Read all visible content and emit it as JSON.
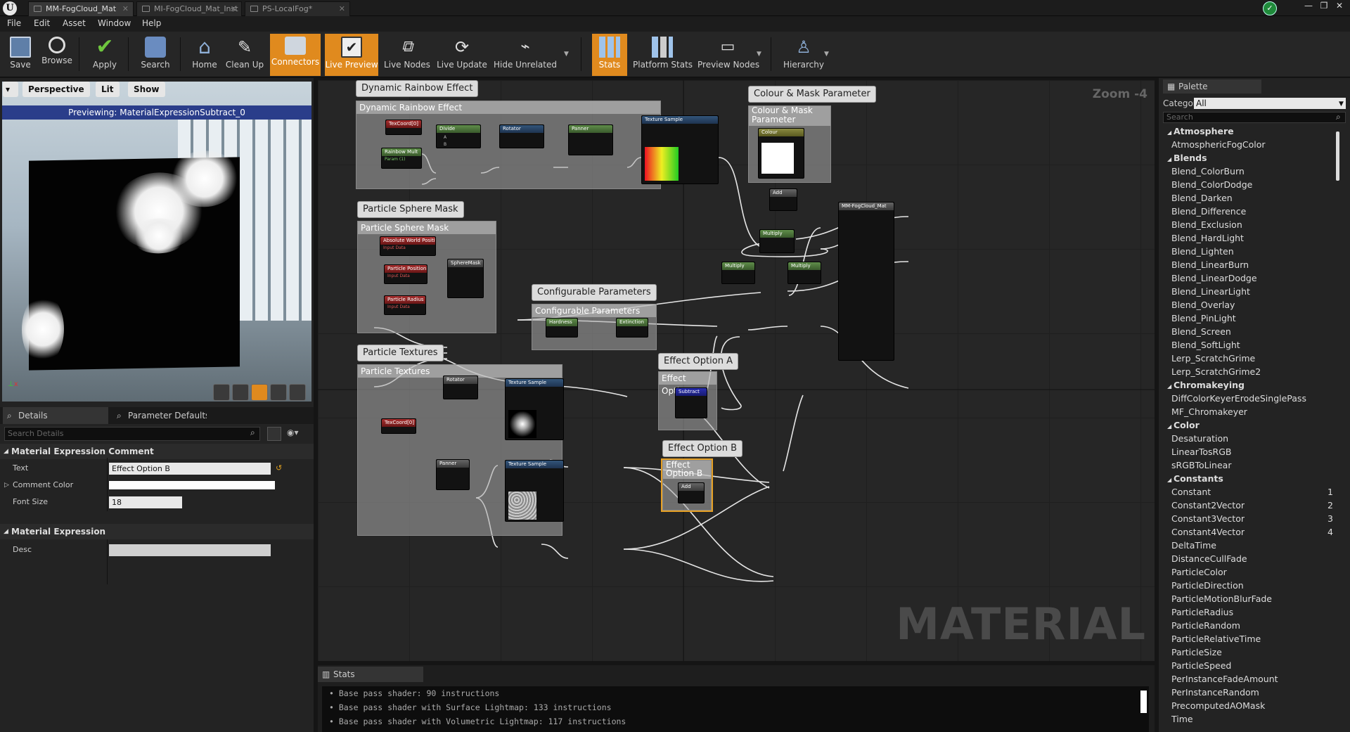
{
  "tabs": [
    {
      "label": "MM-FogCloud_Mat",
      "active": true
    },
    {
      "label": "MI-FogCloud_Mat_Inst"
    },
    {
      "label": "PS-LocalFog*"
    }
  ],
  "menu": [
    "File",
    "Edit",
    "Asset",
    "Window",
    "Help"
  ],
  "toolbar": {
    "save": "Save",
    "browse": "Browse",
    "apply": "Apply",
    "search": "Search",
    "home": "Home",
    "cleanup": "Clean Up",
    "connectors": "Connectors",
    "livepreview": "Live Preview",
    "livenodes": "Live Nodes",
    "liveupdate": "Live Update",
    "hideunrelated": "Hide Unrelated",
    "stats": "Stats",
    "platformstats": "Platform Stats",
    "previewnodes": "Preview Nodes",
    "hierarchy": "Hierarchy"
  },
  "viewport": {
    "perspective": "Perspective",
    "lit": "Lit",
    "show": "Show",
    "caption": "Previewing: MaterialExpressionSubtract_0"
  },
  "details": {
    "tab1": "Details",
    "tab2": "Parameter Defaults",
    "search_placeholder": "Search Details",
    "section1": "Material Expression Comment",
    "text_label": "Text",
    "text_value": "Effect Option B",
    "color_label": "Comment Color",
    "fontsize_label": "Font Size",
    "fontsize_value": "18",
    "section2": "Material Expression",
    "desc_label": "Desc"
  },
  "graph": {
    "zoom": "Zoom -4",
    "watermark": "MATERIAL",
    "comments": {
      "rainbow": "Dynamic Rainbow Effect",
      "colour": "Colour & Mask Parameter",
      "colour_bar": "Colour & Mask Parameter",
      "sphere": "Particle Sphere Mask",
      "config": "Configurable Parameters",
      "textures": "Particle Textures",
      "optA": "Effect Option A",
      "optB": "Effect Option B",
      "optB_bar": "Effect Option B"
    },
    "nodes": {
      "texcoord": "TexCoord[0]",
      "rainbowmult": "Rainbow Mult",
      "divide": "Divide",
      "rotator": "Rotator",
      "panner": "Panner",
      "texsample": "Texture Sample",
      "colour": "Colour",
      "add": "Add",
      "multiply": "Multiply",
      "subtract": "Subtract",
      "mainmat": "MM-FogCloud_Mat",
      "absworld": "Absolute World Position",
      "particlepos": "Particle Position",
      "particleradius": "Particle Radius",
      "spheremask": "SphereMask",
      "hardness": "Hardness",
      "extinction": "Extinction",
      "param": "Param (1)",
      "inputdata": "Input Data"
    }
  },
  "palette": {
    "tab": "Palette",
    "category_label": "Category:",
    "category_value": "All",
    "search_placeholder": "Search",
    "items": [
      {
        "label": "Atmosphere",
        "cat": true
      },
      {
        "label": "AtmosphericFogColor"
      },
      {
        "label": "Blends",
        "cat": true
      },
      {
        "label": "Blend_ColorBurn"
      },
      {
        "label": "Blend_ColorDodge"
      },
      {
        "label": "Blend_Darken"
      },
      {
        "label": "Blend_Difference"
      },
      {
        "label": "Blend_Exclusion"
      },
      {
        "label": "Blend_HardLight"
      },
      {
        "label": "Blend_Lighten"
      },
      {
        "label": "Blend_LinearBurn"
      },
      {
        "label": "Blend_LinearDodge"
      },
      {
        "label": "Blend_LinearLight"
      },
      {
        "label": "Blend_Overlay"
      },
      {
        "label": "Blend_PinLight"
      },
      {
        "label": "Blend_Screen"
      },
      {
        "label": "Blend_SoftLight"
      },
      {
        "label": "Lerp_ScratchGrime"
      },
      {
        "label": "Lerp_ScratchGrime2"
      },
      {
        "label": "Chromakeying",
        "cat": true
      },
      {
        "label": "DiffColorKeyerErodeSinglePass"
      },
      {
        "label": "MF_Chromakeyer"
      },
      {
        "label": "Color",
        "cat": true
      },
      {
        "label": "Desaturation"
      },
      {
        "label": "LinearTosRGB"
      },
      {
        "label": "sRGBToLinear"
      },
      {
        "label": "Constants",
        "cat": true
      },
      {
        "label": "Constant",
        "hk": "1"
      },
      {
        "label": "Constant2Vector",
        "hk": "2"
      },
      {
        "label": "Constant3Vector",
        "hk": "3"
      },
      {
        "label": "Constant4Vector",
        "hk": "4"
      },
      {
        "label": "DeltaTime"
      },
      {
        "label": "DistanceCullFade"
      },
      {
        "label": "ParticleColor"
      },
      {
        "label": "ParticleDirection"
      },
      {
        "label": "ParticleMotionBlurFade"
      },
      {
        "label": "ParticleRadius"
      },
      {
        "label": "ParticleRandom"
      },
      {
        "label": "ParticleRelativeTime"
      },
      {
        "label": "ParticleSize"
      },
      {
        "label": "ParticleSpeed"
      },
      {
        "label": "PerInstanceFadeAmount"
      },
      {
        "label": "PerInstanceRandom"
      },
      {
        "label": "PrecomputedAOMask"
      },
      {
        "label": "Time"
      }
    ]
  },
  "stats": {
    "tab": "Stats",
    "lines": [
      "Base pass shader: 90 instructions",
      "Base pass shader with Surface Lightmap: 133 instructions",
      "Base pass shader with Volumetric Lightmap: 117 instructions"
    ]
  }
}
